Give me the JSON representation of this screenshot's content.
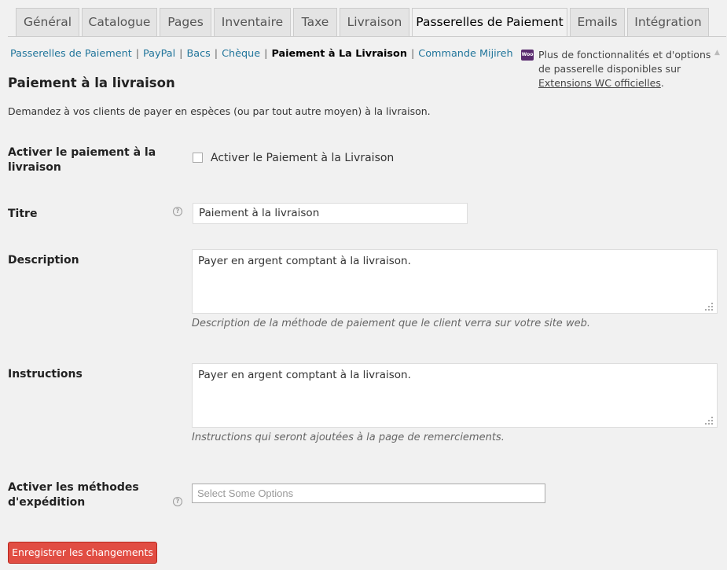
{
  "tabs": [
    {
      "label": "Général"
    },
    {
      "label": "Catalogue"
    },
    {
      "label": "Pages"
    },
    {
      "label": "Inventaire"
    },
    {
      "label": "Taxe"
    },
    {
      "label": "Livraison"
    },
    {
      "label": "Passerelles de Paiement",
      "active": true
    },
    {
      "label": "Emails"
    },
    {
      "label": "Intégration"
    }
  ],
  "subnav": {
    "items": [
      "Passerelles de Paiement",
      "PayPal",
      "Bacs",
      "Chèque",
      "Paiement à La Livraison",
      "Commande Mijireh"
    ],
    "separator": "|"
  },
  "promo": {
    "icon": "woo-icon",
    "icon_text": "Woo",
    "text": "Plus de fonctionnalités et d'options de passerelle disponibles sur",
    "link": "Extensions WC officielles",
    "suffix": "."
  },
  "section": {
    "title": "Paiement à la livraison",
    "intro": "Demandez à vos clients de payer en espèces (ou par tout autre moyen) à la livraison."
  },
  "fields": {
    "enable": {
      "label": "Activer le paiement à la livraison",
      "checkbox_label": "Activer le Paiement à la Livraison",
      "checked": false
    },
    "title": {
      "label": "Titre",
      "value": "Paiement à la livraison",
      "help": "?"
    },
    "description": {
      "label": "Description",
      "value": "Payer en argent comptant à la livraison.",
      "hint": "Description de la méthode de paiement que le client verra sur votre site web."
    },
    "instructions": {
      "label": "Instructions",
      "value": "Payer en argent comptant à la livraison.",
      "hint": "Instructions qui seront ajoutées à la page de remerciements."
    },
    "shipping": {
      "label": "Activer les méthodes d'expédition",
      "placeholder": "Select Some Options",
      "help": "?"
    }
  },
  "save_button": {
    "label": "Enregistrer les changements"
  },
  "colors": {
    "accent_button": "#e14d43",
    "link": "#21759b"
  }
}
